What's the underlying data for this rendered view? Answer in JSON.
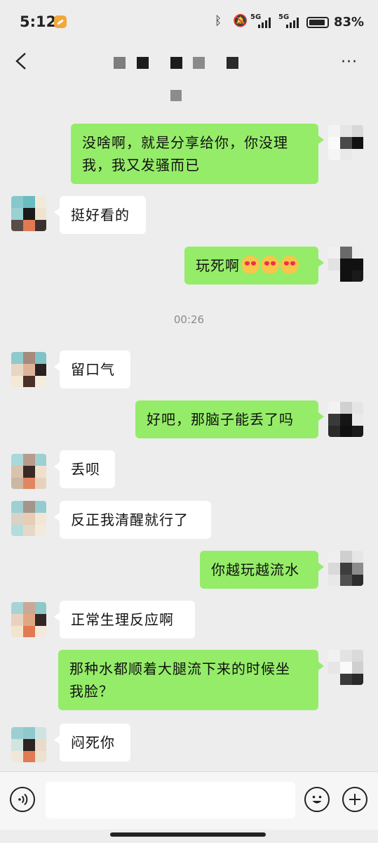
{
  "status_bar": {
    "time": "5:12",
    "network_1": "5G",
    "network_2": "5G",
    "battery": "83%"
  },
  "nav": {
    "back_icon": "chevron-left-icon",
    "more_icon": "more-dots-icon",
    "more_label": "···"
  },
  "messages": [
    {
      "side": "out",
      "text": "没啥啊，就是分享给你，你没理\n我，我又发骚而已"
    },
    {
      "side": "in",
      "text": "挺好看的"
    },
    {
      "side": "out",
      "text": "玩死啊",
      "emoji_count": 3
    },
    {
      "side": "time",
      "text": "00:26"
    },
    {
      "side": "in",
      "text": "留口气"
    },
    {
      "side": "out",
      "text": "好吧，那脑子能丢了吗"
    },
    {
      "side": "in",
      "text": "丢呗"
    },
    {
      "side": "in",
      "text": "反正我清醒就行了"
    },
    {
      "side": "out",
      "text": "你越玩越流水"
    },
    {
      "side": "in",
      "text": "正常生理反应啊"
    },
    {
      "side": "out",
      "text": "那种水都顺着大腿流下来的时候坐\n我脸？"
    },
    {
      "side": "in",
      "text": "闷死你"
    }
  ],
  "input_bar": {
    "voice_icon": "voice-icon",
    "placeholder": "",
    "emoji_icon": "emoji-icon",
    "plus_icon": "plus-icon"
  },
  "colors": {
    "background": "#ededed",
    "outgoing_bubble": "#95ec69",
    "incoming_bubble": "#ffffff"
  }
}
